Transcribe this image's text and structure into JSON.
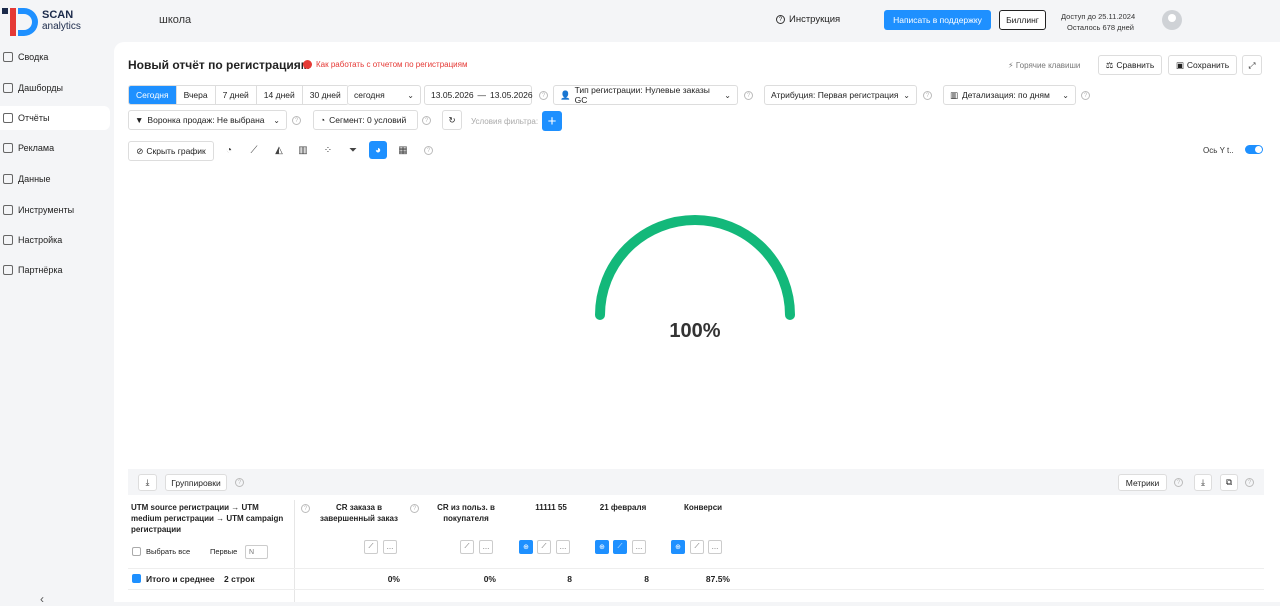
{
  "brand": {
    "line1": "SCAN",
    "line2": "analytics"
  },
  "header": {
    "workspace": "школа",
    "instruction": "Инструкция",
    "support_button": "Написать в поддержку",
    "billing_button": "Биллинг",
    "access_until": "Доступ до 25.11.2024",
    "days_left": "Осталось 678 дней"
  },
  "sidebar": {
    "items": [
      {
        "label": "Сводка"
      },
      {
        "label": "Дашборды"
      },
      {
        "label": "Отчёты"
      },
      {
        "label": "Реклама"
      },
      {
        "label": "Данные"
      },
      {
        "label": "Инструменты"
      },
      {
        "label": "Настройка"
      },
      {
        "label": "Партнёрка"
      }
    ]
  },
  "report": {
    "title": "Новый отчёт по регистрациям",
    "howto": "Как работать с отчетом по регистрациям",
    "hotkeys": "Горячие клавиши",
    "compare": "Сравнить",
    "save": "Сохранить"
  },
  "periods": [
    "Сегодня",
    "Вчера",
    "7 дней",
    "14 дней",
    "30 дней"
  ],
  "filters": {
    "period_select": "сегодня",
    "date_from": "13.05.2026",
    "date_sep": "—",
    "date_to": "13.05.2026",
    "reg_type": "Тип регистрации: Нулевые заказы GC",
    "attribution": "Атрибуция: Первая регистрация",
    "detail": "Детализация:  по дням",
    "funnel": "Воронка продаж: Не выбрана",
    "segment": "Сегмент: 0 условий",
    "filter_placeholder": "Условия фильтра:"
  },
  "chart_toolbar": {
    "hide_chart": "Скрыть график",
    "axis_label": "Ось Y",
    "axis_extra": "t.."
  },
  "chart_data": {
    "type": "gauge",
    "value": 100,
    "max": 100,
    "label": "100%",
    "color": "#13b87a"
  },
  "table": {
    "download_icon": "download-icon",
    "groupings": "Группировки",
    "metrics": "Метрики",
    "group_header": "UTM source регистрации → UTM medium регистрации → UTM campaign регистрации",
    "select_all": "Выбрать все",
    "first": "Первые",
    "first_placeholder": "N",
    "columns": [
      "CR заказа в завершенный заказ",
      "CR из польз. в покупателя",
      "11111 55",
      "21 февраля",
      "Конверси"
    ],
    "total_label": "Итого и среднее",
    "total_count": "2 строк",
    "total_values": [
      "0%",
      "0%",
      "8",
      "8",
      "87.5%"
    ]
  }
}
